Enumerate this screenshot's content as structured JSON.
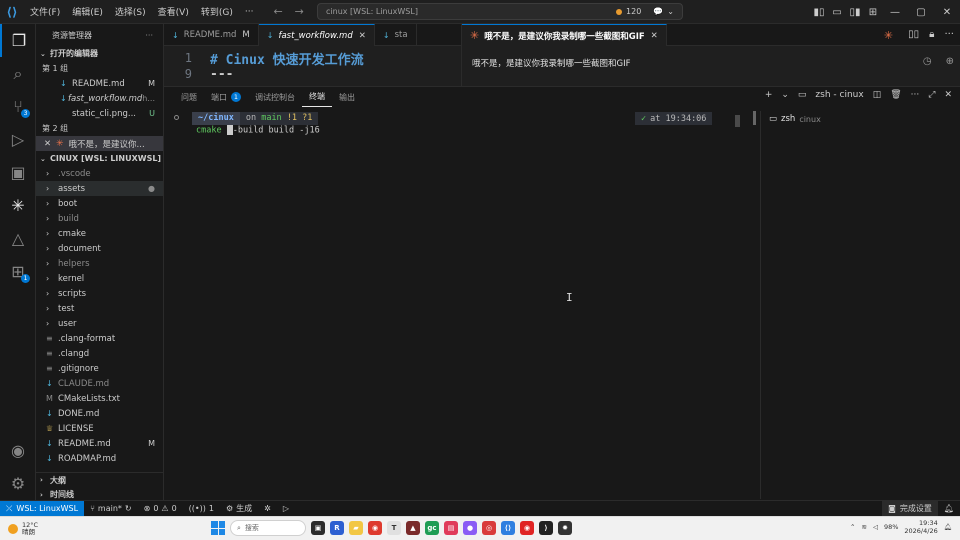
{
  "titlebar": {
    "menus": [
      "文件(F)",
      "编辑(E)",
      "选择(S)",
      "查看(V)",
      "转到(G)"
    ],
    "search_text": "cinux [WSL: LinuxWSL]",
    "badge_count": "120"
  },
  "activity": {
    "scm_count": "3",
    "ext_count": "1"
  },
  "sidebar": {
    "title": "资源管理器",
    "open_editors_label": "打开的编辑器",
    "group1_label": "第 1 组",
    "group1_files": [
      {
        "name": "README.md",
        "status": "M",
        "icon": "markdown-icon"
      },
      {
        "name": "fast_workflow.md",
        "status": "h...",
        "icon": "markdown-icon"
      },
      {
        "name": "static_cli.png...",
        "status": "U",
        "icon": "image-icon"
      }
    ],
    "group2_label": "第 2 组",
    "group2_file": "哦不是，是建议你...",
    "workspace_label": "CINUX [WSL: LINUXWSL]",
    "tree": [
      {
        "name": ".vscode",
        "folder": true,
        "dim": true
      },
      {
        "name": "assets",
        "folder": true,
        "dim": false,
        "dot": true
      },
      {
        "name": "boot",
        "folder": true,
        "dim": false
      },
      {
        "name": "build",
        "folder": true,
        "dim": true
      },
      {
        "name": "cmake",
        "folder": true,
        "dim": false
      },
      {
        "name": "document",
        "folder": true,
        "dim": false
      },
      {
        "name": "helpers",
        "folder": true,
        "dim": true
      },
      {
        "name": "kernel",
        "folder": true,
        "dim": false
      },
      {
        "name": "scripts",
        "folder": true,
        "dim": false
      },
      {
        "name": "test",
        "folder": true,
        "dim": false
      },
      {
        "name": "user",
        "folder": true,
        "dim": false
      },
      {
        "name": ".clang-format",
        "folder": false,
        "dim": false
      },
      {
        "name": ".clangd",
        "folder": false,
        "dim": false
      },
      {
        "name": ".gitignore",
        "folder": false,
        "dim": false
      },
      {
        "name": "CLAUDE.md",
        "folder": false,
        "dim": true
      },
      {
        "name": "CMakeLists.txt",
        "folder": false,
        "dim": false
      },
      {
        "name": "DONE.md",
        "folder": false,
        "dim": false
      },
      {
        "name": "LICENSE",
        "folder": false,
        "dim": false
      },
      {
        "name": "README.md",
        "folder": false,
        "dim": false,
        "status": "M"
      },
      {
        "name": "ROADMAP.md",
        "folder": false,
        "dim": false
      }
    ],
    "outline_label": "大纲",
    "timeline_label": "时间线"
  },
  "editor1": {
    "tabs": [
      {
        "name": "README.md",
        "mod": "M",
        "active": false
      },
      {
        "name": "fast_workflow.md",
        "mod": "",
        "active": true
      },
      {
        "name": "sta",
        "mod": "",
        "active": false
      }
    ],
    "lines": [
      {
        "num": "1",
        "text": "# Cinux 快速开发工作流"
      },
      {
        "num": "9",
        "text": "---"
      }
    ]
  },
  "editor2": {
    "tab_title": "哦不是，是建议你我录制哪一些截图和GIF",
    "message": "哦不是，是建议你我录制哪一些截图和GIF"
  },
  "panel": {
    "tabs": [
      "问题",
      "端口",
      "调试控制台",
      "终端",
      "输出"
    ],
    "ports_count": "1",
    "terminal_name": "zsh - cinux",
    "prompt_path": "~/cinux",
    "prompt_git_on": "on",
    "prompt_branch": "main",
    "prompt_changes": "!1 ?1",
    "prompt_time": "at 19:34:06",
    "command_name": "cmake",
    "command_rest": "-build build -j16",
    "term_list_title": "zsh",
    "term_list_sub": "cinux"
  },
  "status": {
    "remote": "WSL: LinuxWSL",
    "branch": "main*",
    "errors": "0",
    "warnings": "0",
    "ports": "1",
    "build": "生成",
    "setup": "完成设置"
  },
  "taskbar": {
    "temp": "12°C",
    "weather": "晴朗",
    "search": "搜索",
    "time": "19:34",
    "date": "2026/4/26",
    "battery": "98%"
  }
}
